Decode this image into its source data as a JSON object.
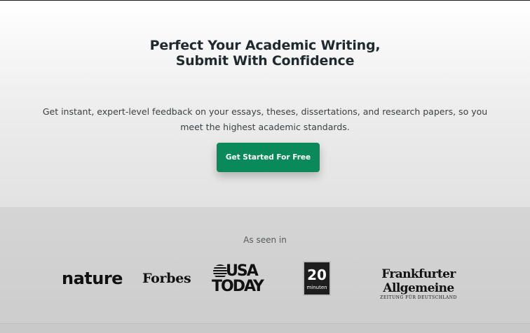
{
  "hero": {
    "title_line1": "Perfect Your Academic Writing,",
    "title_line2": "Submit With Confidence",
    "subtitle": "Get instant, expert-level feedback on your essays, theses, dissertations, and research papers, so you meet the highest academic standards.",
    "cta_label": "Get Started For Free"
  },
  "press": {
    "label": "As seen in",
    "logos": {
      "nature": "nature",
      "forbes": "Forbes",
      "usa_today_line1": "USA",
      "usa_today_line2": "TODAY",
      "twenty_min_number": "20",
      "twenty_min_word": "minuten",
      "faz_main": "Frankfurter Allgemeine",
      "faz_tagline": "ZEITUNG FÜR DEUTSCHLAND"
    }
  },
  "colors": {
    "accent": "#0a8a5a",
    "title_text": "#1f2a2e",
    "body_text": "#3a3f42"
  }
}
